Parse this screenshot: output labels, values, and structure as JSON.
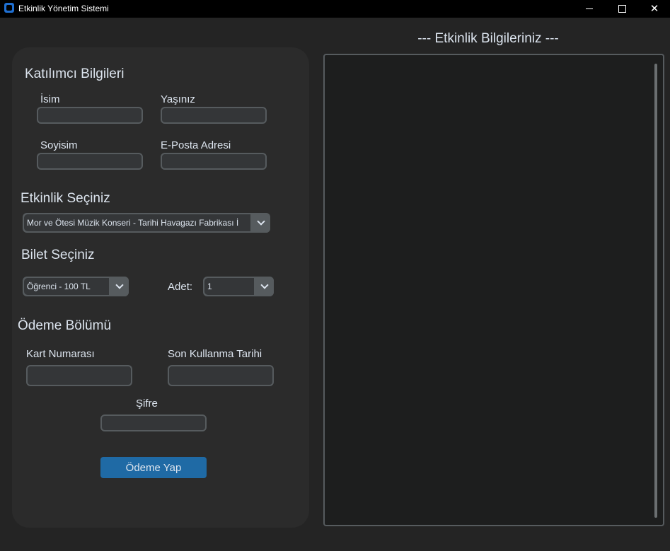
{
  "window": {
    "title": "Etkinlik Yönetim Sistemi",
    "icons": [
      "app-icon",
      "minimize-icon",
      "maximize-icon",
      "close-icon"
    ]
  },
  "participant": {
    "section_title": "Katılımcı Bilgileri",
    "first_name_label": "İsim",
    "age_label": "Yaşınız",
    "last_name_label": "Soyisim",
    "email_label": "E-Posta Adresi",
    "first_name_value": "",
    "age_value": "",
    "last_name_value": "",
    "email_value": ""
  },
  "event": {
    "section_title": "Etkinlik Seçiniz",
    "selected": "Mor ve Ötesi Müzik Konseri - Tarihi Havagazı Fabrikası İ"
  },
  "ticket": {
    "section_title": "Bilet Seçiniz",
    "selected": "Öğrenci - 100 TL",
    "quantity_label": "Adet:",
    "quantity_selected": "1"
  },
  "payment": {
    "section_title": "Ödeme Bölümü",
    "card_number_label": "Kart Numarası",
    "expiry_label": "Son Kullanma Tarihi",
    "password_label": "Şifre",
    "card_number_value": "",
    "expiry_value": "",
    "password_value": "",
    "pay_button_label": "Ödeme Yap"
  },
  "info_panel": {
    "title": "--- Etkinlik Bilgileriniz ---",
    "content": ""
  },
  "colors": {
    "background": "#242424",
    "panel": "#2b2b2b",
    "accent": "#1f6aa5",
    "border": "#565b5e",
    "text": "#dce4ee"
  }
}
